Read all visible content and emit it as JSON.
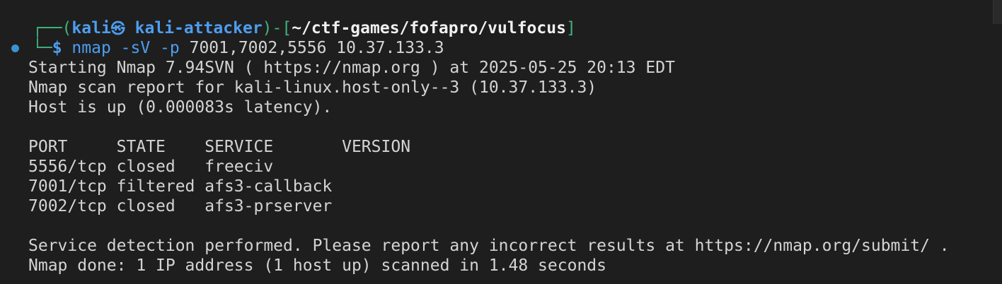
{
  "prompt": {
    "box_top_left": "┌──",
    "paren_open": "(",
    "user": "kali",
    "icon_symbol": "㉿",
    "host": "kali-attacker",
    "paren_close": ")-[",
    "path": "~/ctf-games/fofapro/vulfocus",
    "bracket_close": "]",
    "box_bottom_left": "└─",
    "dollar": "$",
    "command_name": "nmap",
    "command_args": " -sV -p ",
    "command_targets": "7001,7002,5556 10.37.133.3"
  },
  "output": {
    "start_line": "Starting Nmap 7.94SVN ( https://nmap.org ) at 2025-05-25 20:13 EDT",
    "report_line": "Nmap scan report for kali-linux.host-only--3 (10.37.133.3)",
    "host_up_line": "Host is up (0.000083s latency).",
    "table_header": "PORT     STATE    SERVICE       VERSION",
    "rows": [
      "5556/tcp closed   freeciv",
      "7001/tcp filtered afs3-callback",
      "7002/tcp closed   afs3-prserver"
    ],
    "service_detection_line": "Service detection performed. Please report any incorrect results at https://nmap.org/submit/ .",
    "done_line": "Nmap done: 1 IP address (1 host up) scanned in 1.48 seconds"
  },
  "colors": {
    "background": "#1e1e1e",
    "text": "#d4d4d4",
    "prompt_green": "#3fb37f",
    "prompt_blue": "#4d9ef0",
    "marker_blue": "#3a93d0"
  }
}
